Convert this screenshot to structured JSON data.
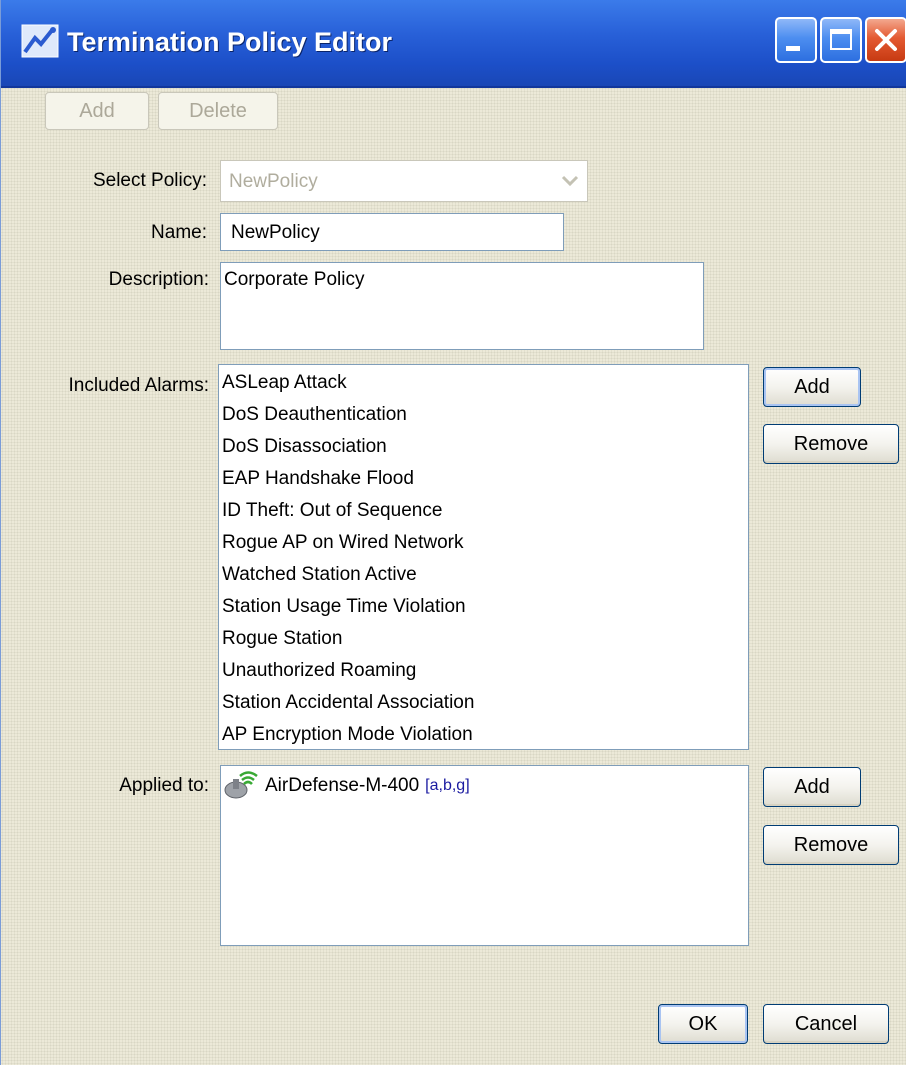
{
  "window": {
    "title": "Termination Policy Editor"
  },
  "toolbar": {
    "add_label": "Add",
    "delete_label": "Delete"
  },
  "form": {
    "select_policy_label": "Select Policy:",
    "select_policy_value": "NewPolicy",
    "name_label": "Name:",
    "name_value": "NewPolicy",
    "description_label": "Description:",
    "description_value": "Corporate Policy",
    "included_alarms_label": "Included Alarms:",
    "alarms": [
      "ASLeap Attack",
      "DoS Deauthentication",
      "DoS Disassociation",
      "EAP Handshake Flood",
      "ID Theft: Out of Sequence",
      "Rogue AP on Wired Network",
      "Watched Station Active",
      "Station Usage Time Violation",
      "Rogue Station",
      "Unauthorized Roaming",
      "Station Accidental Association",
      "AP Encryption Mode Violation"
    ],
    "alarms_add_label": "Add",
    "alarms_remove_label": "Remove",
    "applied_to_label": "Applied to:",
    "applied_items": [
      {
        "name": "AirDefense-M-400",
        "bands": "[a,b,g]",
        "icon": "sensor-icon"
      }
    ],
    "applied_add_label": "Add",
    "applied_remove_label": "Remove"
  },
  "footer": {
    "ok_label": "OK",
    "cancel_label": "Cancel"
  },
  "colors": {
    "titlebar": "#2860d8",
    "dialog_bg": "#ece9d8",
    "band_text": "#1a1aa0",
    "field_border": "#7f9db9"
  }
}
